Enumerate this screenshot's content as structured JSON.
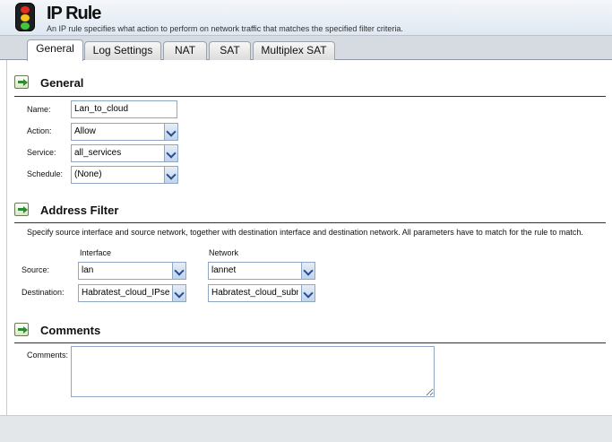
{
  "header": {
    "title": "IP Rule",
    "subtitle": "An IP rule specifies what action to perform on network traffic that matches the specified filter criteria."
  },
  "tabs": [
    {
      "label": "General"
    },
    {
      "label": "Log Settings"
    },
    {
      "label": "NAT"
    },
    {
      "label": "SAT"
    },
    {
      "label": "Multiplex SAT"
    }
  ],
  "general": {
    "title": "General",
    "name_label": "Name:",
    "name_value": "Lan_to_cloud",
    "action_label": "Action:",
    "action_value": "Allow",
    "service_label": "Service:",
    "service_value": "all_services",
    "schedule_label": "Schedule:",
    "schedule_value": "(None)"
  },
  "address_filter": {
    "title": "Address Filter",
    "description": "Specify source interface and source network, together with destination interface and destination network. All parameters have to match for the rule to match.",
    "interface_header": "Interface",
    "network_header": "Network",
    "source_label": "Source:",
    "source_interface": "lan",
    "source_network": "lannet",
    "destination_label": "Destination:",
    "destination_interface": "Habratest_cloud_IPsec",
    "destination_network": "Habratest_cloud_subnet"
  },
  "comments": {
    "title": "Comments",
    "label": "Comments:",
    "value": ""
  },
  "colors": {
    "header_bg": "#e6edf5",
    "field_border": "#8ea7c5",
    "tabbar_bg": "#d6dbe1"
  }
}
